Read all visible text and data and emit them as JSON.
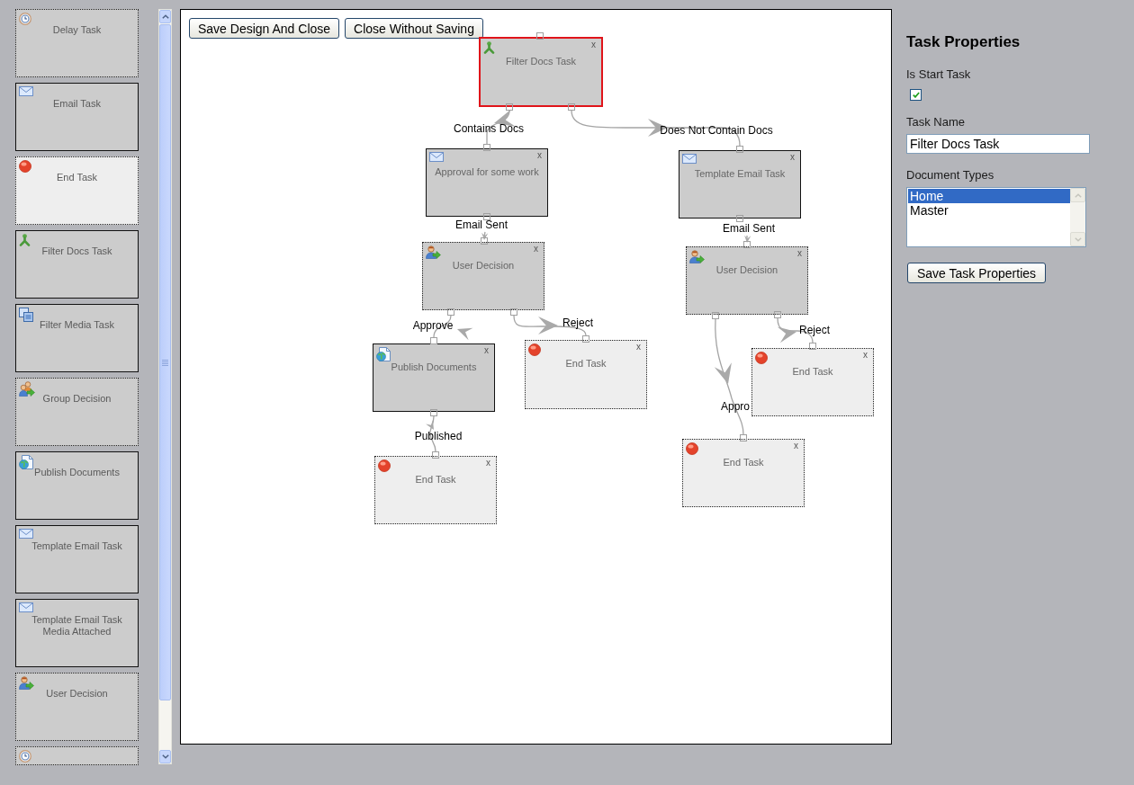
{
  "palette": {
    "items": [
      {
        "label": "Delay Task",
        "kind": "delay"
      },
      {
        "label": "Email Task",
        "kind": "email"
      },
      {
        "label": "End Task",
        "kind": "end"
      },
      {
        "label": "Filter Docs Task",
        "kind": "filter"
      },
      {
        "label": "Filter Media Task",
        "kind": "media"
      },
      {
        "label": "Group Decision",
        "kind": "group"
      },
      {
        "label": "Publish Documents",
        "kind": "publish"
      },
      {
        "label": "Template Email Task",
        "kind": "template"
      },
      {
        "label": "Template Email Task Media Attached",
        "kind": "template"
      },
      {
        "label": "User Decision",
        "kind": "decision"
      },
      {
        "kind": "wait"
      }
    ]
  },
  "toolbar": {
    "buttons": [
      "Save Design And Close",
      "Close Without Saving"
    ]
  },
  "canvas": {
    "nodes": [
      {
        "title": "Filter Docs Task",
        "kind": "filter",
        "selected": true,
        "close": "x"
      },
      {
        "title": "Approval for some work",
        "kind": "email",
        "selected": false,
        "close": "x"
      },
      {
        "title": "Template Email Task",
        "kind": "template",
        "selected": false,
        "close": "x"
      },
      {
        "title": "User Decision",
        "kind": "decision",
        "selected": false,
        "close": "x"
      },
      {
        "title": "User Decision",
        "kind": "decision",
        "selected": false,
        "close": "x"
      },
      {
        "title": "Publish Documents",
        "kind": "publish",
        "selected": false,
        "close": "x"
      },
      {
        "title": "End Task",
        "kind": "end",
        "selected": false,
        "close": "x"
      },
      {
        "title": "End Task",
        "kind": "end",
        "selected": false,
        "close": "x"
      },
      {
        "title": "End Task",
        "kind": "end",
        "selected": false,
        "close": "x"
      },
      {
        "title": "End Task",
        "kind": "end",
        "selected": false,
        "close": "x"
      }
    ],
    "connections": [
      {
        "label": "Contains Docs"
      },
      {
        "label": "Does Not Contain Docs"
      },
      {
        "label": "Email Sent"
      },
      {
        "label": "Email Sent"
      },
      {
        "label": "Approve"
      },
      {
        "label": "Reject"
      },
      {
        "label": "Reject"
      },
      {
        "label": "Appro"
      },
      {
        "label": "Published"
      }
    ]
  },
  "properties": {
    "title": "Task Properties",
    "start_task": {
      "label": "Is Start Task",
      "checked": true
    },
    "task_name": {
      "label": "Task Name",
      "value": "Filter Docs Task"
    },
    "document_types": {
      "label": "Document Types",
      "options": [
        {
          "label": "Home",
          "selected": true
        },
        {
          "label": "Master",
          "selected": false
        }
      ]
    },
    "save_button": "Save Task Properties"
  }
}
